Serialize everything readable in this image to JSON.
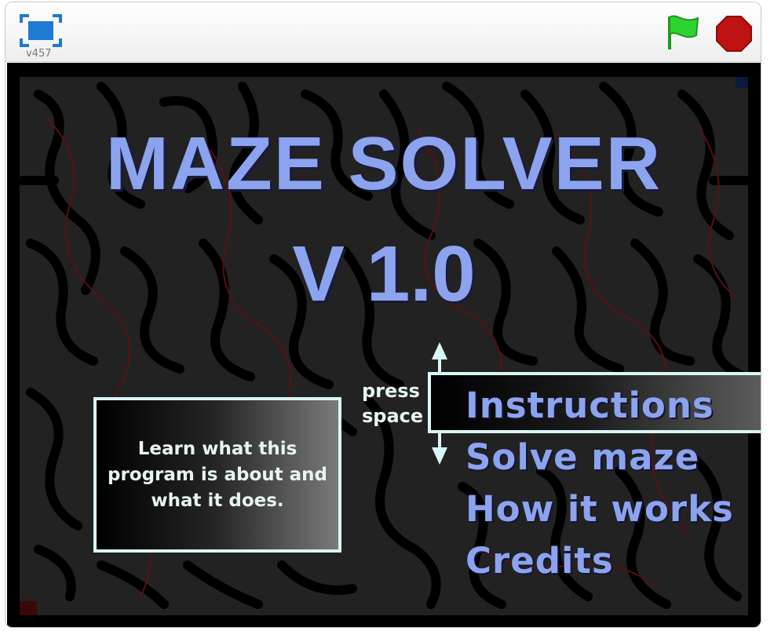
{
  "player": {
    "version": "v457",
    "fullscreen_icon": "fullscreen-icon",
    "flag_icon": "green-flag-icon",
    "stop_icon": "stop-sign-icon"
  },
  "stage": {
    "title_line1": "MAZE SOLVER",
    "title_line2": "V 1.0",
    "hint_line1": "press",
    "hint_line2": "space",
    "menu": [
      "Instructions",
      "Solve maze",
      "How it works",
      "Credits"
    ],
    "selected_index": 0,
    "description": "Learn what this program is about and what it does."
  },
  "colors": {
    "title": "#8ca3f0",
    "panel_border": "#d9f6f6",
    "flag": "#2fd32f",
    "stop": "#bf1212",
    "fullscreen": "#1f7ad1"
  }
}
